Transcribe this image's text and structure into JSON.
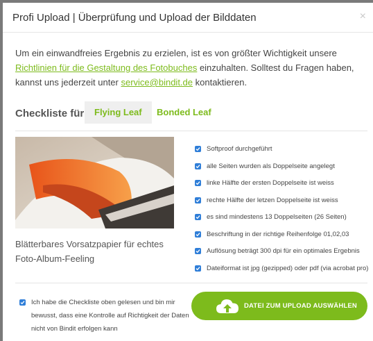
{
  "dialog": {
    "title": "Profi Upload | Überprüfung und Upload der Bilddaten",
    "close_symbol": "×"
  },
  "intro": {
    "text_1": "Um ein einwandfreies Ergebnis zu erzielen, ist es von größter Wichtigkeit unsere ",
    "link_guidelines": "Richtlinien für die Gestaltung des Fotobuches",
    "text_2": " einzuhalten. Solltest du Fragen haben, kannst uns jederzeit unter ",
    "link_email": "service@bindit.de",
    "text_3": " kontaktieren."
  },
  "checklist": {
    "label": "Checkliste für",
    "tabs": [
      {
        "label": "Flying Leaf",
        "active": true
      },
      {
        "label": "Bonded Leaf",
        "active": false
      }
    ]
  },
  "product": {
    "caption": "Blätterbares Vorsatzpapier für echtes Foto-Album-Feeling"
  },
  "checks": [
    "Softproof durchgeführt",
    "alle Seiten wurden als Doppelseite angelegt",
    "linke Hälfte der ersten Doppelseite ist weiss",
    "rechte Hälfte der letzen Doppelseite ist weiss",
    "es sind mindestens 13 Doppelseiten (26 Seiten)",
    "Beschriftung in der richtige Reihenfolge 01,02,03",
    "Auflösung beträgt 300 dpi für ein optimales Ergebnis",
    "Dateiformat ist jpg (gezipped) oder pdf (via acrobat pro)"
  ],
  "confirm": {
    "text": "Ich habe die Checkliste oben gelesen und bin mir bewusst, dass eine Kontrolle auf Richtigkeit der Daten nicht von Bindit erfolgen kann",
    "checked": true
  },
  "upload": {
    "label": "DATEI ZUM UPLOAD AUSWÄHLEN",
    "icon": "cloud-upload-icon"
  },
  "colors": {
    "accent_green": "#7dbb1c",
    "checkbox_blue": "#2f7ed8"
  }
}
